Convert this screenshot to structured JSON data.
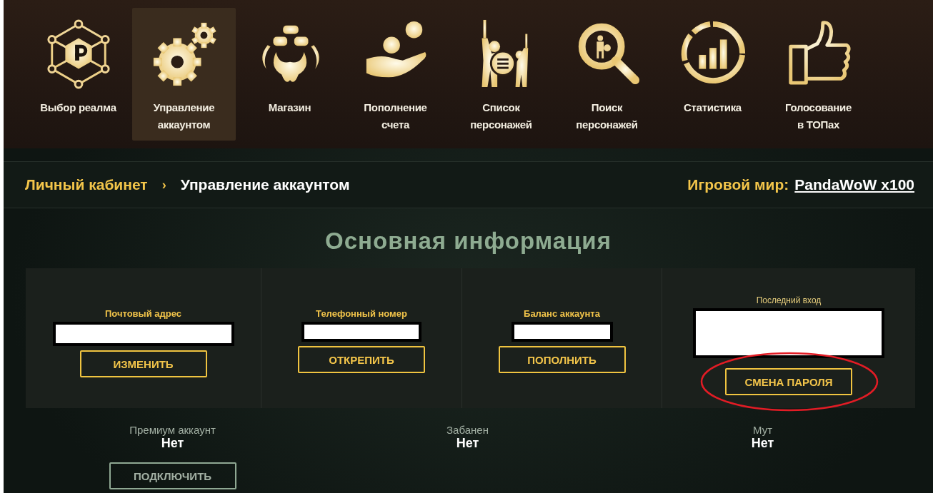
{
  "nav": [
    {
      "label": "Выбор реалма",
      "selected": false
    },
    {
      "label": "Управление\nаккаунтом",
      "selected": true
    },
    {
      "label": "Магазин",
      "selected": false
    },
    {
      "label": "Пополнение\nсчета",
      "selected": false
    },
    {
      "label": "Список\nперсонажей",
      "selected": false
    },
    {
      "label": "Поиск\nперсонажей",
      "selected": false
    },
    {
      "label": "Статистика",
      "selected": false
    },
    {
      "label": "Голосование\nв ТОПах",
      "selected": false
    }
  ],
  "breadcrumb": {
    "root": "Личный кабинет",
    "separator": "›",
    "current": "Управление аккаунтом"
  },
  "realm": {
    "label": "Игровой мир:",
    "value": "PandaWoW x100"
  },
  "title": "Основная информация",
  "fields": [
    {
      "label": "Почтовый адрес",
      "kind": "primary",
      "button": "ИЗМЕНИТЬ",
      "highlighted": false
    },
    {
      "label": "Телефонный номер",
      "kind": "primary",
      "button": "ОТКРЕПИТЬ",
      "highlighted": false
    },
    {
      "label": "Баланс аккаунта",
      "kind": "primary",
      "button": "ПОПОЛНИТЬ",
      "highlighted": false
    },
    {
      "label": "Последний вход",
      "kind": "secondary",
      "button": "СМЕНА ПАРОЛЯ",
      "highlighted": true
    }
  ],
  "statuses": [
    {
      "label": "Премиум аккаунт",
      "value": "Нет",
      "button": "ПОДКЛЮЧИТЬ"
    },
    {
      "label": "Забанен",
      "value": "Нет"
    },
    {
      "label": "Мут",
      "value": "Нет"
    }
  ]
}
